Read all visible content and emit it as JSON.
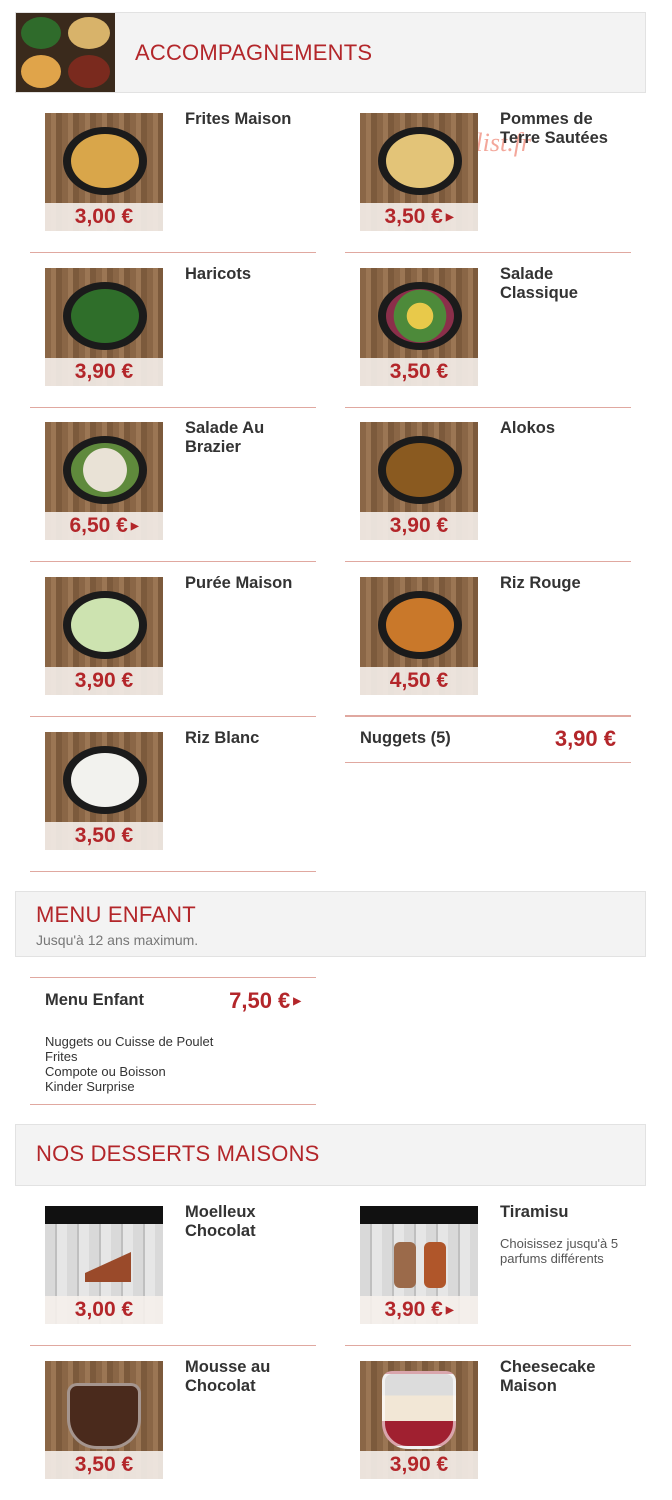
{
  "sections": {
    "accompagnements": {
      "title": "ACCOMPAGNEMENTS"
    },
    "menu_enfant": {
      "title": "MENU ENFANT",
      "subtitle": "Jusqu'à 12 ans maximum."
    },
    "desserts": {
      "title": "NOS DESSERTS MAISONS"
    }
  },
  "watermark": "eat-list.fr",
  "accompagnements": [
    {
      "name": "Frites Maison",
      "price": "3,00 €"
    },
    {
      "name": "Pommes de Terre Sautées",
      "price": "3,50 €"
    },
    {
      "name": "Haricots",
      "price": "3,90 €"
    },
    {
      "name": "Salade Classique",
      "price": "3,50 €"
    },
    {
      "name": "Salade Au Brazier",
      "price": "6,50 €"
    },
    {
      "name": "Alokos",
      "price": "3,90 €"
    },
    {
      "name": "Purée Maison",
      "price": "3,90 €"
    },
    {
      "name": "Riz Rouge",
      "price": "4,50 €"
    },
    {
      "name": "Riz Blanc",
      "price": "3,50 €"
    },
    {
      "name": "Nuggets (5)",
      "price": "3,90 €"
    }
  ],
  "menu_enfant": {
    "name": "Menu Enfant",
    "price": "7,50 €",
    "lines": [
      "Nuggets ou Cuisse de Poulet",
      "Frites",
      "Compote ou Boisson",
      "Kinder Surprise"
    ]
  },
  "desserts": [
    {
      "name": "Moelleux Chocolat",
      "price": "3,00 €"
    },
    {
      "name": "Tiramisu",
      "price": "3,90 €",
      "desc": "Choisissez jusqu'à 5 parfums différents"
    },
    {
      "name": "Mousse au Chocolat",
      "price": "3,50 €"
    },
    {
      "name": "Cheesecake Maison",
      "price": "3,90 €"
    }
  ],
  "colors": {
    "accent": "#b3262a",
    "divider": "#e0a8a0",
    "header_bg": "#f3f3f3"
  }
}
